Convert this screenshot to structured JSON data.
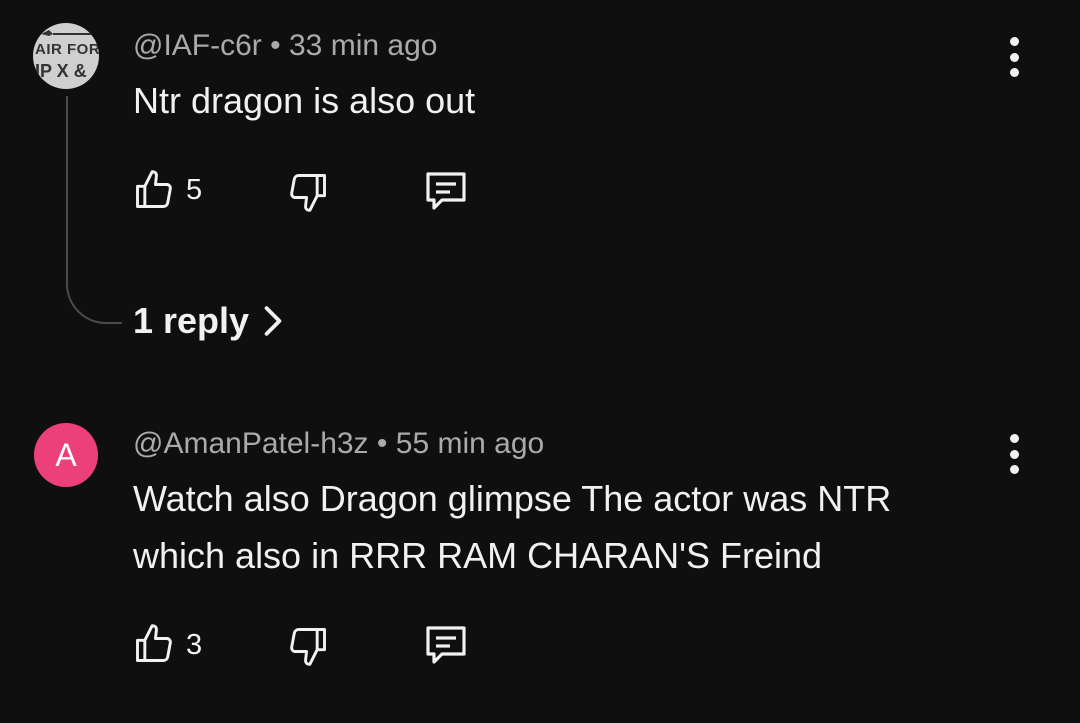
{
  "comments": [
    {
      "avatar_text_line1": "AIR FOR",
      "avatar_text_line2": "IP X &",
      "handle": "@IAF-c6r",
      "separator": "•",
      "time": "33 min ago",
      "text": "Ntr dragon is also out",
      "likes": "5",
      "replies_label": "1 reply",
      "icons": [
        "thumbs-up-icon",
        "thumbs-down-icon",
        "comment-icon",
        "more-vert-icon",
        "chevron-right-icon"
      ]
    },
    {
      "avatar_letter": "A",
      "avatar_color": "#ec407a",
      "handle": "@AmanPatel-h3z",
      "separator": "•",
      "time": "55 min ago",
      "text_line1": "Watch also Dragon glimpse The actor was NTR",
      "text_line2": "which also in RRR RAM CHARAN'S Freind",
      "likes": "3",
      "icons": [
        "thumbs-up-icon",
        "thumbs-down-icon",
        "comment-icon",
        "more-vert-icon"
      ]
    }
  ],
  "colors": {
    "background": "#0f0f0f",
    "text": "#f1f1f1",
    "meta": "#aaaaaa",
    "thread_line": "#4a4a4a"
  }
}
